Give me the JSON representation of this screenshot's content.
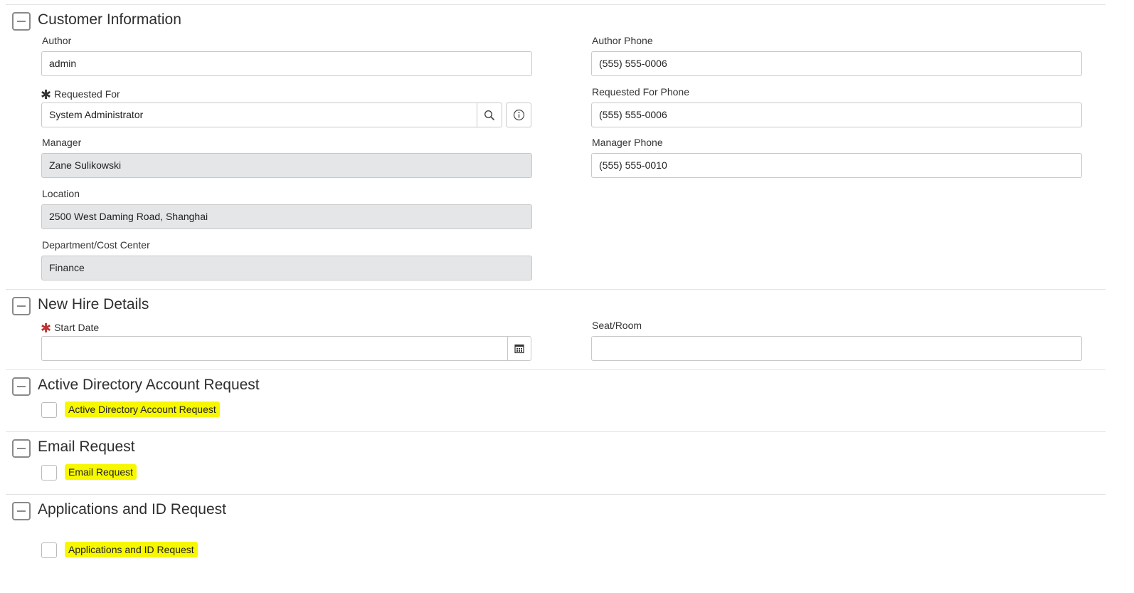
{
  "sections": {
    "customer": {
      "title": "Customer Information",
      "author": {
        "label": "Author",
        "value": "admin"
      },
      "requested_for": {
        "label": "Requested For",
        "value": "System Administrator"
      },
      "manager": {
        "label": "Manager",
        "value": "Zane Sulikowski"
      },
      "location": {
        "label": "Location",
        "value": "2500 West Daming Road, Shanghai"
      },
      "department": {
        "label": "Department/Cost Center",
        "value": "Finance"
      },
      "author_phone": {
        "label": "Author Phone",
        "value": "(555) 555-0006"
      },
      "requested_for_phone": {
        "label": "Requested For Phone",
        "value": "(555) 555-0006"
      },
      "manager_phone": {
        "label": "Manager Phone",
        "value": "(555) 555-0010"
      }
    },
    "new_hire": {
      "title": "New Hire Details",
      "start_date": {
        "label": "Start Date",
        "value": ""
      },
      "seat_room": {
        "label": "Seat/Room",
        "value": ""
      }
    },
    "ad": {
      "title": "Active Directory Account Request",
      "checkbox_label": "Active Directory Account Request"
    },
    "email": {
      "title": "Email Request",
      "checkbox_label": "Email Request"
    },
    "apps": {
      "title": "Applications and ID Request",
      "checkbox_label": "Applications and ID Request"
    }
  },
  "required_marker": "✱",
  "colors": {
    "required_active": "#b33",
    "required_satisfied": "#222",
    "highlight": "#f7f700"
  }
}
